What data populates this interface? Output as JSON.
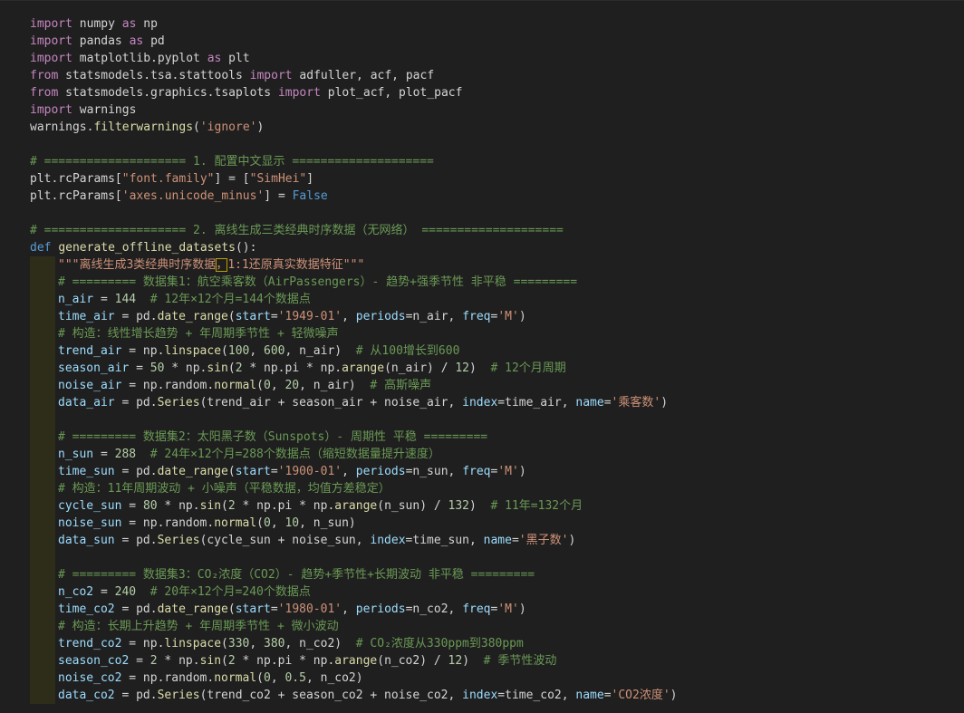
{
  "colors": {
    "background": "#1f1f1f",
    "keyword": "#c586c0",
    "def_keyword": "#569cd6",
    "function": "#dcdcaa",
    "string": "#ce9178",
    "number": "#b5cea8",
    "comment": "#6a9955",
    "variable": "#9cdcfe",
    "text": "#d4d4d4",
    "indent_guide": "#2d2d1a",
    "bracket_highlight": "#b8a000"
  },
  "code": {
    "lines": [
      {
        "indent": 0,
        "tokens": [
          {
            "t": "kw",
            "v": "import"
          },
          {
            "t": "tx",
            "v": " numpy "
          },
          {
            "t": "kw",
            "v": "as"
          },
          {
            "t": "tx",
            "v": " np"
          }
        ]
      },
      {
        "indent": 0,
        "tokens": [
          {
            "t": "kw",
            "v": "import"
          },
          {
            "t": "tx",
            "v": " pandas "
          },
          {
            "t": "kw",
            "v": "as"
          },
          {
            "t": "tx",
            "v": " pd"
          }
        ]
      },
      {
        "indent": 0,
        "tokens": [
          {
            "t": "kw",
            "v": "import"
          },
          {
            "t": "tx",
            "v": " matplotlib.pyplot "
          },
          {
            "t": "kw",
            "v": "as"
          },
          {
            "t": "tx",
            "v": " plt"
          }
        ]
      },
      {
        "indent": 0,
        "tokens": [
          {
            "t": "kw",
            "v": "from"
          },
          {
            "t": "tx",
            "v": " statsmodels.tsa.stattools "
          },
          {
            "t": "kw",
            "v": "import"
          },
          {
            "t": "tx",
            "v": " adfuller, acf, pacf"
          }
        ]
      },
      {
        "indent": 0,
        "tokens": [
          {
            "t": "kw",
            "v": "from"
          },
          {
            "t": "tx",
            "v": " statsmodels.graphics.tsaplots "
          },
          {
            "t": "kw",
            "v": "import"
          },
          {
            "t": "tx",
            "v": " plot_acf, plot_pacf"
          }
        ]
      },
      {
        "indent": 0,
        "tokens": [
          {
            "t": "kw",
            "v": "import"
          },
          {
            "t": "tx",
            "v": " warnings"
          }
        ]
      },
      {
        "indent": 0,
        "tokens": [
          {
            "t": "tx",
            "v": "warnings."
          },
          {
            "t": "fn",
            "v": "filterwarnings"
          },
          {
            "t": "tx",
            "v": "("
          },
          {
            "t": "str",
            "v": "'ignore'"
          },
          {
            "t": "tx",
            "v": ")"
          }
        ]
      },
      {
        "indent": 0,
        "tokens": []
      },
      {
        "indent": 0,
        "tokens": [
          {
            "t": "cm",
            "v": "# ==================== 1. 配置中文显示 ===================="
          }
        ]
      },
      {
        "indent": 0,
        "tokens": [
          {
            "t": "tx",
            "v": "plt.rcParams["
          },
          {
            "t": "str",
            "v": "\"font.family\""
          },
          {
            "t": "tx",
            "v": "] = ["
          },
          {
            "t": "str",
            "v": "\"SimHei\""
          },
          {
            "t": "tx",
            "v": "]"
          }
        ]
      },
      {
        "indent": 0,
        "tokens": [
          {
            "t": "tx",
            "v": "plt.rcParams["
          },
          {
            "t": "str",
            "v": "'axes.unicode_minus'"
          },
          {
            "t": "tx",
            "v": "] = "
          },
          {
            "t": "def",
            "v": "False"
          }
        ]
      },
      {
        "indent": 0,
        "tokens": []
      },
      {
        "indent": 0,
        "tokens": [
          {
            "t": "cm",
            "v": "# ==================== 2. 离线生成三类经典时序数据（无网络） ===================="
          }
        ]
      },
      {
        "indent": 0,
        "tokens": [
          {
            "t": "def",
            "v": "def"
          },
          {
            "t": "tx",
            "v": " "
          },
          {
            "t": "fn",
            "v": "generate_offline_datasets"
          },
          {
            "t": "tx",
            "v": "():"
          }
        ]
      },
      {
        "indent": 1,
        "tokens": [
          {
            "t": "str",
            "v": "\"\"\"离线生成3类经典时序数据"
          },
          {
            "t": "str",
            "v": "，",
            "hl": true
          },
          {
            "t": "str",
            "v": "1:1还原真实数据特征\"\"\""
          }
        ]
      },
      {
        "indent": 1,
        "tokens": [
          {
            "t": "cm",
            "v": "# ========= 数据集1：航空乘客数（AirPassengers）- 趋势+强季节性 非平稳 ========="
          }
        ]
      },
      {
        "indent": 1,
        "tokens": [
          {
            "t": "var",
            "v": "n_air"
          },
          {
            "t": "tx",
            "v": " = "
          },
          {
            "t": "num",
            "v": "144"
          },
          {
            "t": "tx",
            "v": "  "
          },
          {
            "t": "cm",
            "v": "# 12年×12个月=144个数据点"
          }
        ]
      },
      {
        "indent": 1,
        "tokens": [
          {
            "t": "var",
            "v": "time_air"
          },
          {
            "t": "tx",
            "v": " = pd."
          },
          {
            "t": "fn",
            "v": "date_range"
          },
          {
            "t": "tx",
            "v": "("
          },
          {
            "t": "var",
            "v": "start"
          },
          {
            "t": "tx",
            "v": "="
          },
          {
            "t": "str",
            "v": "'1949-01'"
          },
          {
            "t": "tx",
            "v": ", "
          },
          {
            "t": "var",
            "v": "periods"
          },
          {
            "t": "tx",
            "v": "=n_air, "
          },
          {
            "t": "var",
            "v": "freq"
          },
          {
            "t": "tx",
            "v": "="
          },
          {
            "t": "str",
            "v": "'M'"
          },
          {
            "t": "tx",
            "v": ")"
          }
        ]
      },
      {
        "indent": 1,
        "tokens": [
          {
            "t": "cm",
            "v": "# 构造：线性增长趋势 + 年周期季节性 + 轻微噪声"
          }
        ]
      },
      {
        "indent": 1,
        "tokens": [
          {
            "t": "var",
            "v": "trend_air"
          },
          {
            "t": "tx",
            "v": " = np."
          },
          {
            "t": "fn",
            "v": "linspace"
          },
          {
            "t": "tx",
            "v": "("
          },
          {
            "t": "num",
            "v": "100"
          },
          {
            "t": "tx",
            "v": ", "
          },
          {
            "t": "num",
            "v": "600"
          },
          {
            "t": "tx",
            "v": ", n_air)  "
          },
          {
            "t": "cm",
            "v": "# 从100增长到600"
          }
        ]
      },
      {
        "indent": 1,
        "tokens": [
          {
            "t": "var",
            "v": "season_air"
          },
          {
            "t": "tx",
            "v": " = "
          },
          {
            "t": "num",
            "v": "50"
          },
          {
            "t": "tx",
            "v": " * np."
          },
          {
            "t": "fn",
            "v": "sin"
          },
          {
            "t": "tx",
            "v": "("
          },
          {
            "t": "num",
            "v": "2"
          },
          {
            "t": "tx",
            "v": " * np.pi * np."
          },
          {
            "t": "fn",
            "v": "arange"
          },
          {
            "t": "tx",
            "v": "(n_air) / "
          },
          {
            "t": "num",
            "v": "12"
          },
          {
            "t": "tx",
            "v": ")  "
          },
          {
            "t": "cm",
            "v": "# 12个月周期"
          }
        ]
      },
      {
        "indent": 1,
        "tokens": [
          {
            "t": "var",
            "v": "noise_air"
          },
          {
            "t": "tx",
            "v": " = np.random."
          },
          {
            "t": "fn",
            "v": "normal"
          },
          {
            "t": "tx",
            "v": "("
          },
          {
            "t": "num",
            "v": "0"
          },
          {
            "t": "tx",
            "v": ", "
          },
          {
            "t": "num",
            "v": "20"
          },
          {
            "t": "tx",
            "v": ", n_air)  "
          },
          {
            "t": "cm",
            "v": "# 高斯噪声"
          }
        ]
      },
      {
        "indent": 1,
        "tokens": [
          {
            "t": "var",
            "v": "data_air"
          },
          {
            "t": "tx",
            "v": " = pd."
          },
          {
            "t": "fn",
            "v": "Series"
          },
          {
            "t": "tx",
            "v": "(trend_air + season_air + noise_air, "
          },
          {
            "t": "var",
            "v": "index"
          },
          {
            "t": "tx",
            "v": "=time_air, "
          },
          {
            "t": "var",
            "v": "name"
          },
          {
            "t": "tx",
            "v": "="
          },
          {
            "t": "str",
            "v": "'乘客数'"
          },
          {
            "t": "tx",
            "v": ")"
          }
        ]
      },
      {
        "indent": 1,
        "tokens": []
      },
      {
        "indent": 1,
        "tokens": [
          {
            "t": "cm",
            "v": "# ========= 数据集2：太阳黑子数（Sunspots）- 周期性 平稳 ========="
          }
        ]
      },
      {
        "indent": 1,
        "tokens": [
          {
            "t": "var",
            "v": "n_sun"
          },
          {
            "t": "tx",
            "v": " = "
          },
          {
            "t": "num",
            "v": "288"
          },
          {
            "t": "tx",
            "v": "  "
          },
          {
            "t": "cm",
            "v": "# 24年×12个月=288个数据点（缩短数据量提升速度）"
          }
        ]
      },
      {
        "indent": 1,
        "tokens": [
          {
            "t": "var",
            "v": "time_sun"
          },
          {
            "t": "tx",
            "v": " = pd."
          },
          {
            "t": "fn",
            "v": "date_range"
          },
          {
            "t": "tx",
            "v": "("
          },
          {
            "t": "var",
            "v": "start"
          },
          {
            "t": "tx",
            "v": "="
          },
          {
            "t": "str",
            "v": "'1900-01'"
          },
          {
            "t": "tx",
            "v": ", "
          },
          {
            "t": "var",
            "v": "periods"
          },
          {
            "t": "tx",
            "v": "=n_sun, "
          },
          {
            "t": "var",
            "v": "freq"
          },
          {
            "t": "tx",
            "v": "="
          },
          {
            "t": "str",
            "v": "'M'"
          },
          {
            "t": "tx",
            "v": ")"
          }
        ]
      },
      {
        "indent": 1,
        "tokens": [
          {
            "t": "cm",
            "v": "# 构造：11年周期波动 + 小噪声（平稳数据，均值方差稳定）"
          }
        ]
      },
      {
        "indent": 1,
        "tokens": [
          {
            "t": "var",
            "v": "cycle_sun"
          },
          {
            "t": "tx",
            "v": " = "
          },
          {
            "t": "num",
            "v": "80"
          },
          {
            "t": "tx",
            "v": " * np."
          },
          {
            "t": "fn",
            "v": "sin"
          },
          {
            "t": "tx",
            "v": "("
          },
          {
            "t": "num",
            "v": "2"
          },
          {
            "t": "tx",
            "v": " * np.pi * np."
          },
          {
            "t": "fn",
            "v": "arange"
          },
          {
            "t": "tx",
            "v": "(n_sun) / "
          },
          {
            "t": "num",
            "v": "132"
          },
          {
            "t": "tx",
            "v": ")  "
          },
          {
            "t": "cm",
            "v": "# 11年=132个月"
          }
        ]
      },
      {
        "indent": 1,
        "tokens": [
          {
            "t": "var",
            "v": "noise_sun"
          },
          {
            "t": "tx",
            "v": " = np.random."
          },
          {
            "t": "fn",
            "v": "normal"
          },
          {
            "t": "tx",
            "v": "("
          },
          {
            "t": "num",
            "v": "0"
          },
          {
            "t": "tx",
            "v": ", "
          },
          {
            "t": "num",
            "v": "10"
          },
          {
            "t": "tx",
            "v": ", n_sun)"
          }
        ]
      },
      {
        "indent": 1,
        "tokens": [
          {
            "t": "var",
            "v": "data_sun"
          },
          {
            "t": "tx",
            "v": " = pd."
          },
          {
            "t": "fn",
            "v": "Series"
          },
          {
            "t": "tx",
            "v": "(cycle_sun + noise_sun, "
          },
          {
            "t": "var",
            "v": "index"
          },
          {
            "t": "tx",
            "v": "=time_sun, "
          },
          {
            "t": "var",
            "v": "name"
          },
          {
            "t": "tx",
            "v": "="
          },
          {
            "t": "str",
            "v": "'黑子数'"
          },
          {
            "t": "tx",
            "v": ")"
          }
        ]
      },
      {
        "indent": 1,
        "tokens": []
      },
      {
        "indent": 1,
        "tokens": [
          {
            "t": "cm",
            "v": "# ========= 数据集3：CO₂浓度（CO2）- 趋势+季节性+长期波动 非平稳 ========="
          }
        ]
      },
      {
        "indent": 1,
        "tokens": [
          {
            "t": "var",
            "v": "n_co2"
          },
          {
            "t": "tx",
            "v": " = "
          },
          {
            "t": "num",
            "v": "240"
          },
          {
            "t": "tx",
            "v": "  "
          },
          {
            "t": "cm",
            "v": "# 20年×12个月=240个数据点"
          }
        ]
      },
      {
        "indent": 1,
        "tokens": [
          {
            "t": "var",
            "v": "time_co2"
          },
          {
            "t": "tx",
            "v": " = pd."
          },
          {
            "t": "fn",
            "v": "date_range"
          },
          {
            "t": "tx",
            "v": "("
          },
          {
            "t": "var",
            "v": "start"
          },
          {
            "t": "tx",
            "v": "="
          },
          {
            "t": "str",
            "v": "'1980-01'"
          },
          {
            "t": "tx",
            "v": ", "
          },
          {
            "t": "var",
            "v": "periods"
          },
          {
            "t": "tx",
            "v": "=n_co2, "
          },
          {
            "t": "var",
            "v": "freq"
          },
          {
            "t": "tx",
            "v": "="
          },
          {
            "t": "str",
            "v": "'M'"
          },
          {
            "t": "tx",
            "v": ")"
          }
        ]
      },
      {
        "indent": 1,
        "tokens": [
          {
            "t": "cm",
            "v": "# 构造：长期上升趋势 + 年周期季节性 + 微小波动"
          }
        ]
      },
      {
        "indent": 1,
        "tokens": [
          {
            "t": "var",
            "v": "trend_co2"
          },
          {
            "t": "tx",
            "v": " = np."
          },
          {
            "t": "fn",
            "v": "linspace"
          },
          {
            "t": "tx",
            "v": "("
          },
          {
            "t": "num",
            "v": "330"
          },
          {
            "t": "tx",
            "v": ", "
          },
          {
            "t": "num",
            "v": "380"
          },
          {
            "t": "tx",
            "v": ", n_co2)  "
          },
          {
            "t": "cm",
            "v": "# CO₂浓度从330ppm到380ppm"
          }
        ]
      },
      {
        "indent": 1,
        "tokens": [
          {
            "t": "var",
            "v": "season_co2"
          },
          {
            "t": "tx",
            "v": " = "
          },
          {
            "t": "num",
            "v": "2"
          },
          {
            "t": "tx",
            "v": " * np."
          },
          {
            "t": "fn",
            "v": "sin"
          },
          {
            "t": "tx",
            "v": "("
          },
          {
            "t": "num",
            "v": "2"
          },
          {
            "t": "tx",
            "v": " * np.pi * np."
          },
          {
            "t": "fn",
            "v": "arange"
          },
          {
            "t": "tx",
            "v": "(n_co2) / "
          },
          {
            "t": "num",
            "v": "12"
          },
          {
            "t": "tx",
            "v": ")  "
          },
          {
            "t": "cm",
            "v": "# 季节性波动"
          }
        ]
      },
      {
        "indent": 1,
        "tokens": [
          {
            "t": "var",
            "v": "noise_co2"
          },
          {
            "t": "tx",
            "v": " = np.random."
          },
          {
            "t": "fn",
            "v": "normal"
          },
          {
            "t": "tx",
            "v": "("
          },
          {
            "t": "num",
            "v": "0"
          },
          {
            "t": "tx",
            "v": ", "
          },
          {
            "t": "num",
            "v": "0.5"
          },
          {
            "t": "tx",
            "v": ", n_co2)"
          }
        ]
      },
      {
        "indent": 1,
        "tokens": [
          {
            "t": "var",
            "v": "data_co2"
          },
          {
            "t": "tx",
            "v": " = pd."
          },
          {
            "t": "fn",
            "v": "Series"
          },
          {
            "t": "tx",
            "v": "(trend_co2 + season_co2 + noise_co2, "
          },
          {
            "t": "var",
            "v": "index"
          },
          {
            "t": "tx",
            "v": "=time_co2, "
          },
          {
            "t": "var",
            "v": "name"
          },
          {
            "t": "tx",
            "v": "="
          },
          {
            "t": "str",
            "v": "'CO2浓度'"
          },
          {
            "t": "tx",
            "v": ")"
          }
        ]
      }
    ]
  }
}
